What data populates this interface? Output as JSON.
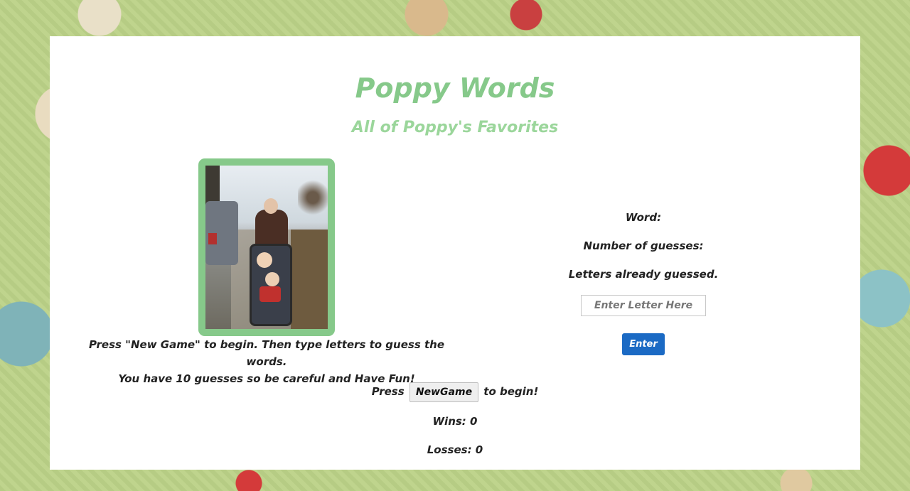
{
  "header": {
    "title": "Poppy Words",
    "subtitle": "All of Poppy's Favorites"
  },
  "instructions": {
    "line1": "Press \"New Game\" to begin. Then type letters to guess the words.",
    "line2": "You have 10 guesses so be careful and Have Fun!"
  },
  "game": {
    "word_label": "Word:",
    "guesses_label": "Number of guesses:",
    "letters_label": "Letters already guessed.",
    "letter_input_placeholder": "Enter Letter Here",
    "letter_input_value": "",
    "enter_label": "Enter"
  },
  "start": {
    "prefix": "Press",
    "button_label": "NewGame",
    "suffix": "to begin!"
  },
  "stats": {
    "wins": "Wins: 0",
    "losses": "Losses: 0"
  },
  "colors": {
    "accent_green": "#86c98a",
    "subtitle_green": "#9bd69b",
    "button_blue": "#1b6ac4"
  }
}
